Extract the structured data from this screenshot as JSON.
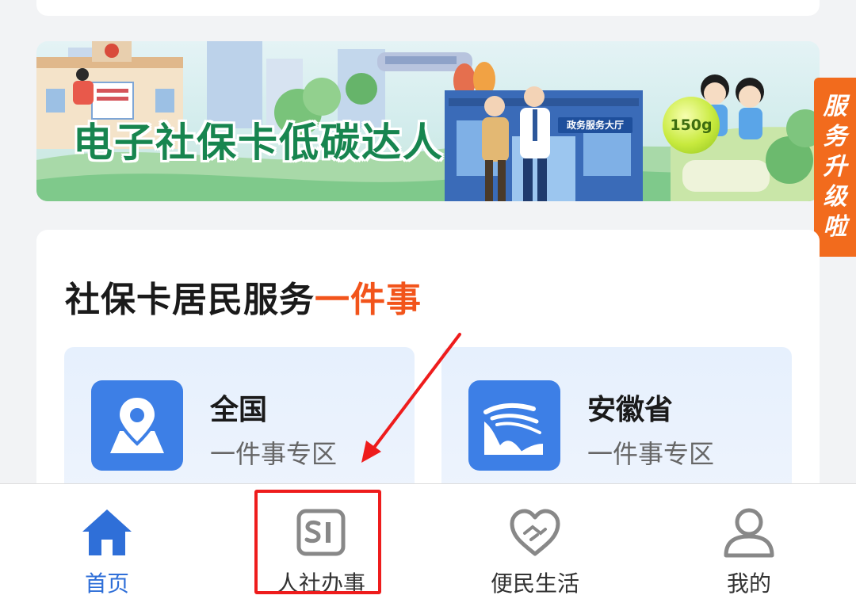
{
  "banner": {
    "title": "电子社保卡低碳达人",
    "hall_sign": "政务服务大厅",
    "weight_badge": "150g",
    "active_slide": 3,
    "slide_count": 3
  },
  "side_tab": {
    "chars": [
      "服",
      "务",
      "升",
      "级",
      "啦"
    ]
  },
  "service_section": {
    "title_main": "社保卡居民服务",
    "title_accent": "一件事",
    "zones": [
      {
        "name": "全国",
        "sub": "一件事专区",
        "icon": "location-pin-icon"
      },
      {
        "name": "安徽省",
        "sub": "一件事专区",
        "icon": "huangshan-pine-icon"
      }
    ]
  },
  "tabbar": {
    "tabs": [
      {
        "label": "首页",
        "icon": "home-icon",
        "active": true
      },
      {
        "label": "人社办事",
        "icon": "si-icon",
        "active": false
      },
      {
        "label": "便民生活",
        "icon": "heart-handshake-icon",
        "active": false
      },
      {
        "label": "我的",
        "icon": "user-icon",
        "active": false
      }
    ]
  },
  "colors": {
    "primary_blue": "#3d7fe6",
    "accent_orange": "#f2541b",
    "side_tab_orange": "#f26b1d",
    "banner_green": "#17854f",
    "annotation_red": "#ee1c1c"
  }
}
